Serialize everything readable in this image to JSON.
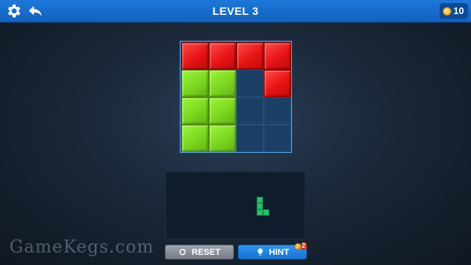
{
  "header": {
    "title": "LEVEL 3",
    "coins": "10",
    "settings_icon": "gear-icon",
    "back_icon": "undo-arrow-icon"
  },
  "board": {
    "rows": 4,
    "cols": 4,
    "grid": [
      [
        "red",
        "red",
        "red",
        "red"
      ],
      [
        "green",
        "green",
        "empty",
        "red"
      ],
      [
        "green",
        "green",
        "empty",
        "empty"
      ],
      [
        "green",
        "green",
        "empty",
        "empty"
      ]
    ]
  },
  "tray": {
    "piece_color": "#22c26a",
    "piece_cells": [
      [
        0,
        0
      ],
      [
        1,
        0
      ],
      [
        2,
        0
      ],
      [
        2,
        1
      ]
    ]
  },
  "buttons": {
    "reset_label": "RESET",
    "hint_label": "HINT",
    "hint_badge": "2"
  },
  "watermark": "GameKegs.com",
  "colors": {
    "topbar": "#1c78d9",
    "red": "#e71414",
    "green": "#7bd61e",
    "empty": "#1b3f67"
  }
}
